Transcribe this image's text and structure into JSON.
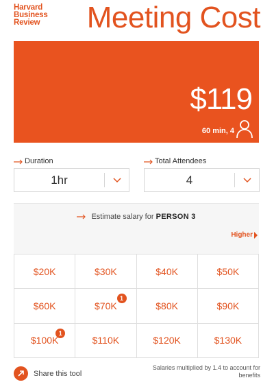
{
  "brand": {
    "logo_lines": [
      "Harvard",
      "Business",
      "Review"
    ],
    "accent_color": "#e9531f"
  },
  "header": {
    "title": "Meeting Cost"
  },
  "cost": {
    "amount": "$119",
    "summary": "60 min, 4",
    "icon": "person-icon"
  },
  "duration": {
    "label": "Duration",
    "value": "1hr",
    "icon": "chevron-down-icon"
  },
  "attendees": {
    "label": "Total Attendees",
    "value": "4",
    "icon": "chevron-down-icon"
  },
  "salary": {
    "prompt": "Estimate salary for",
    "person": "PERSON 3",
    "higher_label": "Higher",
    "options": [
      {
        "label": "$20K",
        "count": ""
      },
      {
        "label": "$30K",
        "count": ""
      },
      {
        "label": "$40K",
        "count": ""
      },
      {
        "label": "$50K",
        "count": ""
      },
      {
        "label": "$60K",
        "count": ""
      },
      {
        "label": "$70K",
        "count": "1"
      },
      {
        "label": "$80K",
        "count": ""
      },
      {
        "label": "$90K",
        "count": ""
      },
      {
        "label": "$100K",
        "count": "1"
      },
      {
        "label": "$110K",
        "count": ""
      },
      {
        "label": "$120K",
        "count": ""
      },
      {
        "label": "$130K",
        "count": ""
      }
    ]
  },
  "footer": {
    "share_label": "Share this tool",
    "share_icon": "share-arrow-icon",
    "note": "Salaries multiplied by 1.4 to account for benefits"
  }
}
